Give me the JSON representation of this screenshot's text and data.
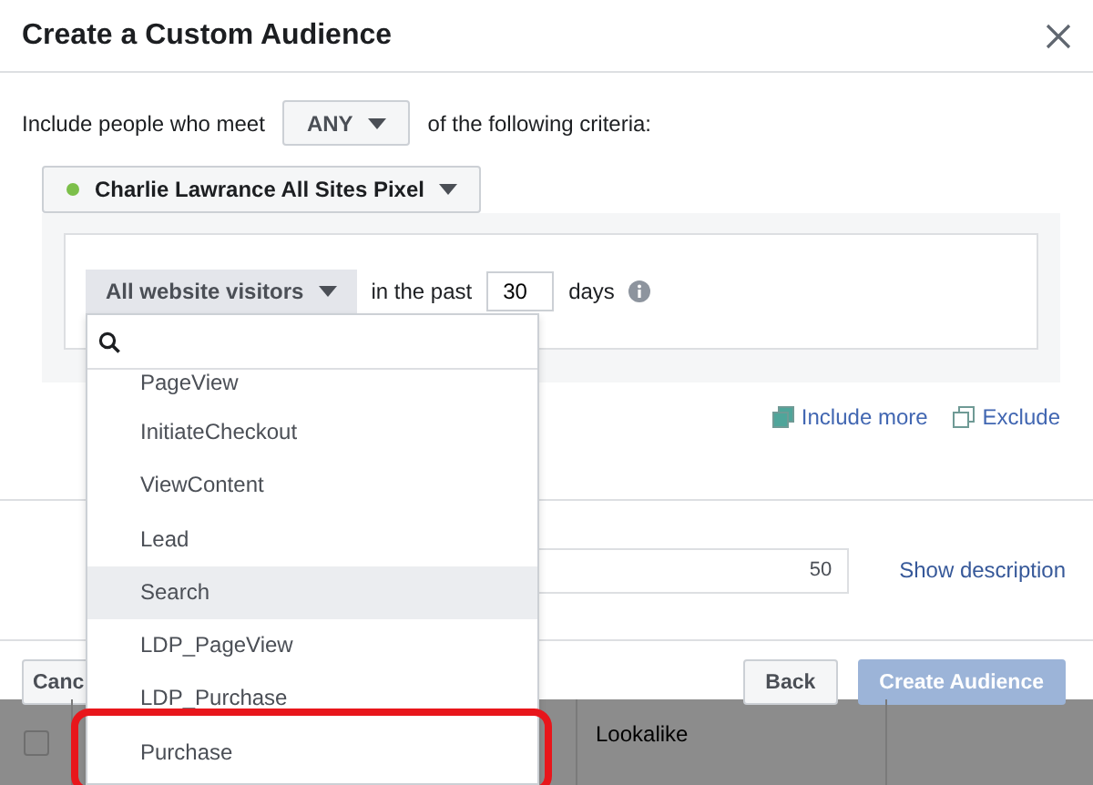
{
  "dialog": {
    "title": "Create a Custom Audience",
    "criteria": {
      "prefix": "Include people who meet",
      "match": "ANY",
      "suffix": "of the following criteria:"
    },
    "pixel": {
      "name": "Charlie Lawrance All Sites Pixel"
    },
    "rule": {
      "event": "All website visitors",
      "in_the_past": "in the past",
      "days_value": "30",
      "days_label": "days"
    },
    "links": [
      {
        "label": "Include more",
        "kind": "include"
      },
      {
        "label": "Exclude",
        "kind": "exclude"
      }
    ],
    "name_field": {
      "count": "50"
    },
    "show_description": "Show description",
    "buttons": [
      {
        "label": "Canc",
        "kind": "secondary",
        "disabled": false
      },
      {
        "label": "Back",
        "kind": "secondary",
        "disabled": false
      },
      {
        "label": "Create Audience",
        "kind": "primary",
        "disabled": true
      }
    ]
  },
  "dropdown": {
    "items": [
      {
        "label": "PageView",
        "hovered": false,
        "circled": false
      },
      {
        "label": "InitiateCheckout",
        "hovered": false,
        "circled": false
      },
      {
        "label": "ViewContent",
        "hovered": false,
        "circled": false
      },
      {
        "label": "Lead",
        "hovered": false,
        "circled": false
      },
      {
        "label": "Search",
        "hovered": true,
        "circled": false
      },
      {
        "label": "LDP_PageView",
        "hovered": false,
        "circled": false
      },
      {
        "label": "LDP_Purchase",
        "hovered": false,
        "circled": false
      },
      {
        "label": "Purchase",
        "hovered": false,
        "circled": true
      }
    ]
  },
  "background_table": {
    "rows": [
      {
        "checked": false,
        "column_2": "Lookalike"
      }
    ]
  }
}
